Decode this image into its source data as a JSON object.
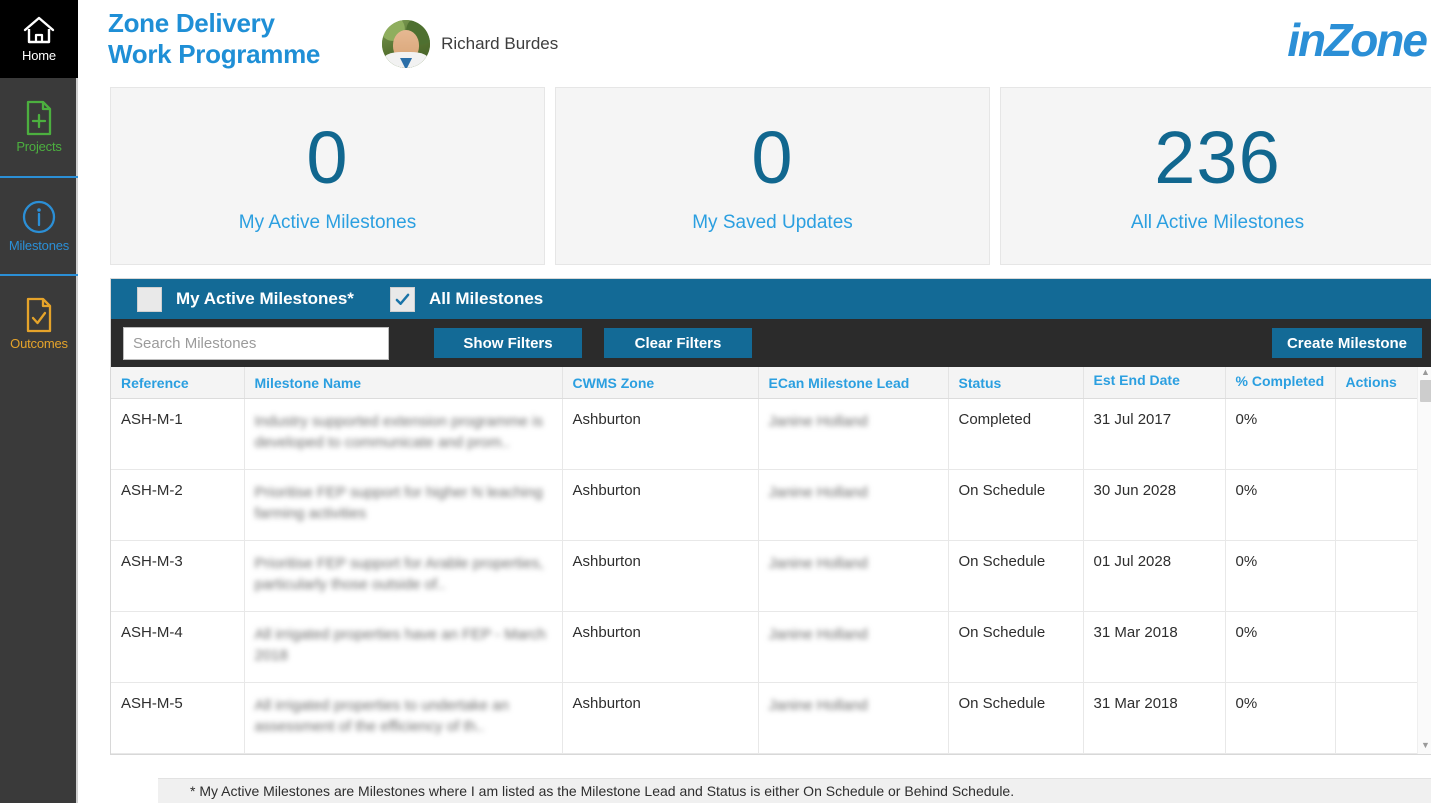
{
  "sidebar": {
    "items": [
      {
        "label": "Home",
        "icon": "home-icon"
      },
      {
        "label": "Projects",
        "icon": "document-plus-icon"
      },
      {
        "label": "Milestones",
        "icon": "info-circle-icon"
      },
      {
        "label": "Outcomes",
        "icon": "document-check-icon"
      }
    ]
  },
  "header": {
    "title_line1": "Zone Delivery",
    "title_line2": "Work Programme",
    "user_name": "Richard Burdes",
    "logo_text": "inZone"
  },
  "cards": [
    {
      "value": "0",
      "label": "My Active Milestones"
    },
    {
      "value": "0",
      "label": "My Saved Updates"
    },
    {
      "value": "236",
      "label": "All Active Milestones"
    }
  ],
  "filters": {
    "checkbox_my_active_label": "My Active Milestones*",
    "checkbox_my_active_checked": false,
    "checkbox_all_label": "All Milestones",
    "checkbox_all_checked": true,
    "search_placeholder": "Search Milestones",
    "search_value": "",
    "show_filters_label": "Show Filters",
    "clear_filters_label": "Clear Filters",
    "create_milestone_label": "Create Milestone"
  },
  "table": {
    "columns": [
      "Reference",
      "Milestone Name",
      "CWMS Zone",
      "ECan Milestone Lead",
      "Status",
      "Est End Date",
      "% Completed",
      "Actions"
    ],
    "rows": [
      {
        "reference": "ASH-M-1",
        "name": "Industry supported extension programme is developed to communicate and prom..",
        "zone": "Ashburton",
        "lead": "Janine Holland",
        "status": "Completed",
        "est_end_date": "31 Jul 2017",
        "percent_completed": "0%",
        "actions": ""
      },
      {
        "reference": "ASH-M-2",
        "name": "Prioritise FEP support for higher N leaching farming activities",
        "zone": "Ashburton",
        "lead": "Janine Holland",
        "status": "On Schedule",
        "est_end_date": "30 Jun 2028",
        "percent_completed": "0%",
        "actions": ""
      },
      {
        "reference": "ASH-M-3",
        "name": "Prioritise FEP support for Arable properties, particularly those outside of..",
        "zone": "Ashburton",
        "lead": "Janine Holland",
        "status": "On Schedule",
        "est_end_date": "01 Jul 2028",
        "percent_completed": "0%",
        "actions": ""
      },
      {
        "reference": "ASH-M-4",
        "name": "All irrigated properties have an FEP - March 2018",
        "zone": "Ashburton",
        "lead": "Janine Holland",
        "status": "On Schedule",
        "est_end_date": "31 Mar 2018",
        "percent_completed": "0%",
        "actions": ""
      },
      {
        "reference": "ASH-M-5",
        "name": "All irrigated properties to undertake an assessment of the efficiency of th..",
        "zone": "Ashburton",
        "lead": "Janine Holland",
        "status": "On Schedule",
        "est_end_date": "31 Mar 2018",
        "percent_completed": "0%",
        "actions": ""
      }
    ]
  },
  "footnote": "* My Active Milestones are Milestones where I am listed as the Milestone Lead and Status is either On Schedule or Behind Schedule.",
  "colors": {
    "brand_blue": "#2b8fd6",
    "header_teal": "#136a96",
    "card_number": "#11678f",
    "card_label": "#2b9fe0",
    "sidebar_bg": "#3a3a3a",
    "projects_green": "#4caf3f",
    "outcomes_orange": "#e5a32a",
    "filter_dark": "#2b2b2b"
  }
}
